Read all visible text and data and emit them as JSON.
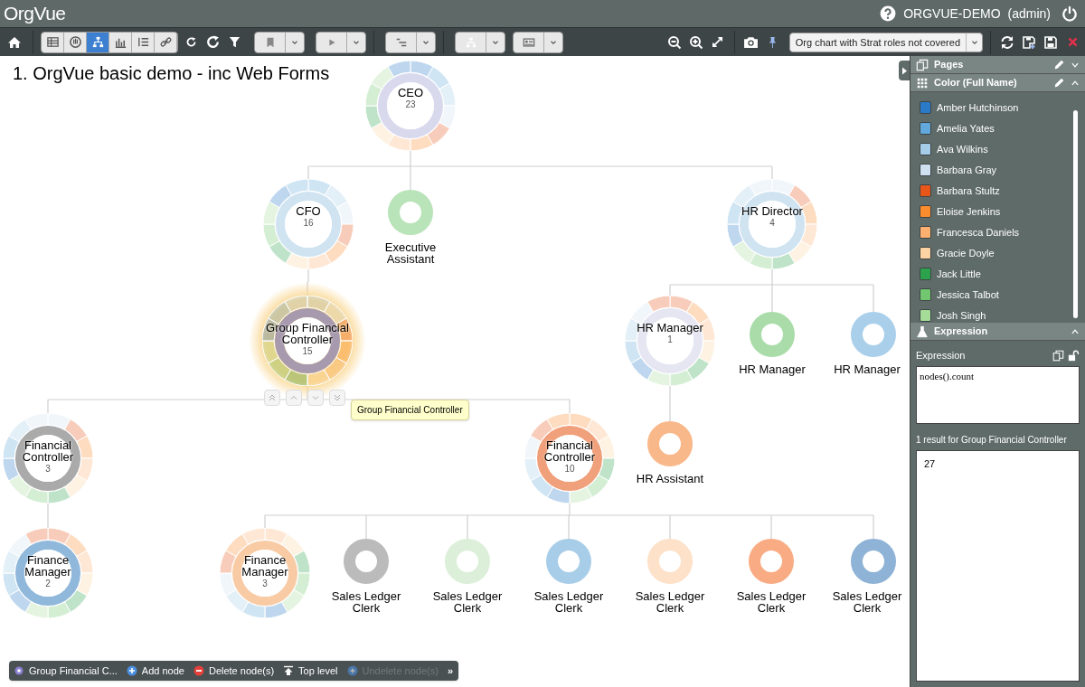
{
  "header": {
    "logo": "OrgVue",
    "workspace": "ORGVUE-DEMO",
    "user": "(admin)"
  },
  "toolbar": {
    "view_buttons": [
      {
        "selected": false
      },
      {
        "selected": false
      },
      {
        "selected": true
      },
      {
        "selected": false
      },
      {
        "selected": false
      },
      {
        "selected": false
      }
    ],
    "saved_view": "Org chart with Strat roles not covered"
  },
  "canvas": {
    "title": "1. OrgVue basic demo - inc Web Forms",
    "tree": [
      {
        "title": "CEO",
        "count": "23",
        "kind": "summary",
        "color": "#d9d9ee",
        "selected": false,
        "children": [
          {
            "title": "CFO",
            "count": "16",
            "kind": "summary",
            "color": "#cfe3f1",
            "selected": false,
            "children": [
              {
                "title": "Group Financial Controller",
                "count": "15",
                "kind": "summary",
                "color": "#a89aae",
                "selected": true,
                "children": [
                  {
                    "title": "Financial Controller",
                    "count": "3",
                    "kind": "summary",
                    "color": "#aaaaaa",
                    "selected": false,
                    "children": [
                      {
                        "title": "Finance Manager",
                        "count": "2",
                        "kind": "summary",
                        "color": "#8fb8db",
                        "selected": false
                      }
                    ]
                  },
                  {
                    "title": "Financial Controller",
                    "count": "10",
                    "kind": "summary",
                    "color": "#f0a07a",
                    "selected": false,
                    "children": [
                      {
                        "title": "Finance Manager",
                        "count": "3",
                        "kind": "summary",
                        "color": "#f8cba4",
                        "selected": false
                      },
                      {
                        "title": "Sales Ledger Clerk",
                        "kind": "leaf",
                        "color": "#bbbbbb",
                        "selected": false
                      },
                      {
                        "title": "Sales Ledger Clerk",
                        "kind": "leaf",
                        "color": "#dcefd9",
                        "selected": false
                      },
                      {
                        "title": "Sales Ledger Clerk",
                        "kind": "leaf",
                        "color": "#a8cde8",
                        "selected": false
                      },
                      {
                        "title": "Sales Ledger Clerk",
                        "kind": "leaf",
                        "color": "#fde1c8",
                        "selected": false
                      },
                      {
                        "title": "Sales Ledger Clerk",
                        "kind": "leaf",
                        "color": "#f9ac84",
                        "selected": false
                      },
                      {
                        "title": "Sales Ledger Clerk",
                        "kind": "leaf",
                        "color": "#8fb3d6",
                        "selected": false
                      }
                    ]
                  }
                ]
              }
            ]
          },
          {
            "title": "Executive Assistant",
            "kind": "leaf",
            "color": "#b9e3b9",
            "selected": false
          },
          {
            "title": "HR Director",
            "count": "4",
            "kind": "summary",
            "color": "#cfe3f1",
            "selected": false,
            "children": [
              {
                "title": "HR Manager",
                "count": "1",
                "kind": "summary",
                "color": "#e6e6f3",
                "selected": false,
                "children": [
                  {
                    "title": "HR Assistant",
                    "kind": "leaf",
                    "color": "#f9b88a",
                    "selected": false
                  }
                ]
              },
              {
                "title": "HR Manager",
                "kind": "leaf",
                "color": "#a9dca9",
                "selected": false
              },
              {
                "title": "HR Manager",
                "kind": "leaf",
                "color": "#a9cfea",
                "selected": false
              }
            ]
          }
        ]
      }
    ],
    "tooltip": "Group Financial Controller"
  },
  "action_bar": {
    "selection": "Group Financial C...",
    "actions": [
      {
        "label": "Add node",
        "kind": "add",
        "disabled": false
      },
      {
        "label": "Delete node(s)",
        "kind": "delete",
        "disabled": false
      },
      {
        "label": "Top level",
        "kind": "top",
        "disabled": false
      },
      {
        "label": "Undelete node(s)",
        "kind": "undelete",
        "disabled": true
      }
    ],
    "more": "»"
  },
  "panel": {
    "sections": [
      {
        "title": "Pages",
        "kind": "pages",
        "expanded": false
      },
      {
        "title": "Color (Full Name)",
        "kind": "legend",
        "expanded": true
      },
      {
        "title": "Expression",
        "kind": "expression",
        "expanded": true
      }
    ],
    "legend": [
      {
        "name": "Amber Hutchinson",
        "color": "#2a7ac8"
      },
      {
        "name": "Amelia Yates",
        "color": "#62a8dc"
      },
      {
        "name": "Ava Wilkins",
        "color": "#a5cde9"
      },
      {
        "name": "Barbara Gray",
        "color": "#cfe0f3"
      },
      {
        "name": "Barbara Stultz",
        "color": "#e8561a"
      },
      {
        "name": "Eloise Jenkins",
        "color": "#fb8c2e"
      },
      {
        "name": "Francesca Daniels",
        "color": "#fdb070"
      },
      {
        "name": "Gracie Doyle",
        "color": "#fdd3a3"
      },
      {
        "name": "Jack Little",
        "color": "#2ca24c"
      },
      {
        "name": "Jessica Talbot",
        "color": "#72c66f"
      },
      {
        "name": "Josh Singh",
        "color": "#a4dc98"
      }
    ],
    "expression_label": "Expression",
    "expression": "nodes().count",
    "result_label": "1 result for Group Financial Controller",
    "result": "27"
  }
}
